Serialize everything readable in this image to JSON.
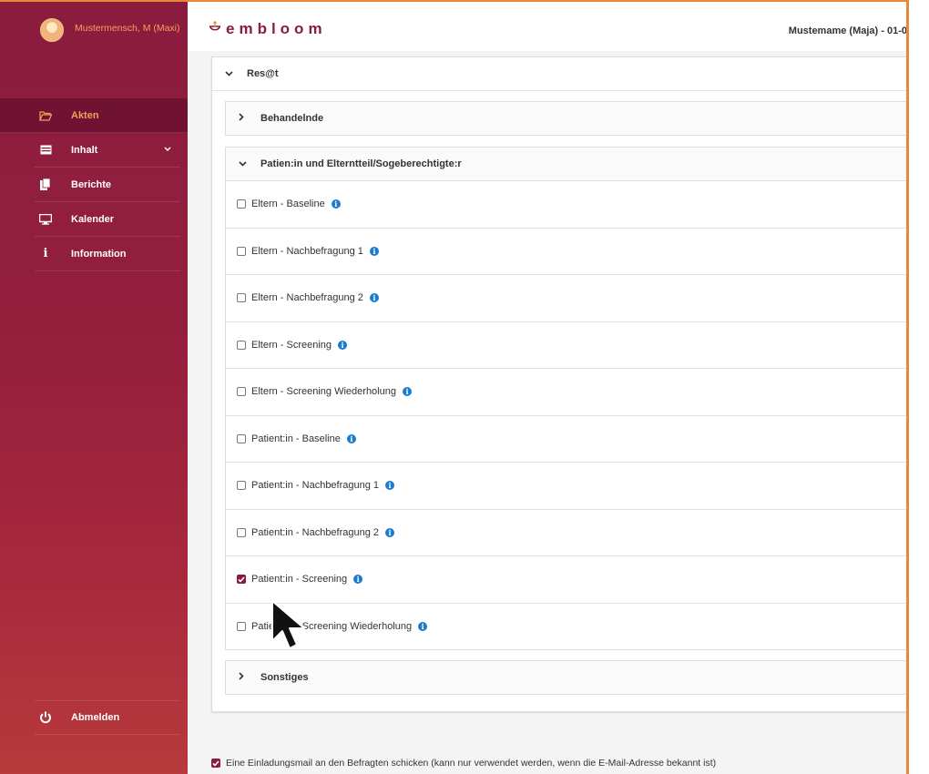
{
  "user": {
    "name": "Mustermensch, M (Maxi)"
  },
  "nav": {
    "items": [
      {
        "label": "Akten",
        "icon": "folder-open-icon"
      },
      {
        "label": "Inhalt",
        "icon": "table-icon"
      },
      {
        "label": "Berichte",
        "icon": "document-icon"
      },
      {
        "label": "Kalender",
        "icon": "monitor-icon"
      },
      {
        "label": "Information",
        "icon": "info-icon"
      }
    ],
    "logout_label": "Abmelden"
  },
  "header": {
    "logo": "embloom",
    "user_label": "Mustemame (Maja) - 01-0"
  },
  "panel": {
    "title": "Res@t",
    "sections": {
      "behandelnde": "Behandelnde",
      "patient": "Patien:in und Elterntteil/Sogeberechtigte:r",
      "sonstiges": "Sonstiges"
    },
    "items": [
      {
        "label": "Eltern - Baseline",
        "checked": false
      },
      {
        "label": "Eltern - Nachbefragung 1",
        "checked": false
      },
      {
        "label": "Eltern - Nachbefragung 2",
        "checked": false
      },
      {
        "label": "Eltern - Screening",
        "checked": false
      },
      {
        "label": "Eltern - Screening Wiederholung",
        "checked": false
      },
      {
        "label": "Patient:in - Baseline",
        "checked": false
      },
      {
        "label": "Patient:in - Nachbefragung 1",
        "checked": false
      },
      {
        "label": "Patient:in - Nachbefragung 2",
        "checked": false
      },
      {
        "label": "Patient:in - Screening",
        "checked": true
      },
      {
        "label": "Patient:in - Screening Wiederholung",
        "checked": false
      }
    ]
  },
  "invite": {
    "label": "Eine Einladungsmail an den Befragten schicken (kann nur verwendet werden, wenn die E-Mail-Adresse bekannt ist)",
    "checked": true
  },
  "colors": {
    "brand": "#8a1c3e",
    "accent": "#f2a05a",
    "info": "#1a7bd0"
  }
}
